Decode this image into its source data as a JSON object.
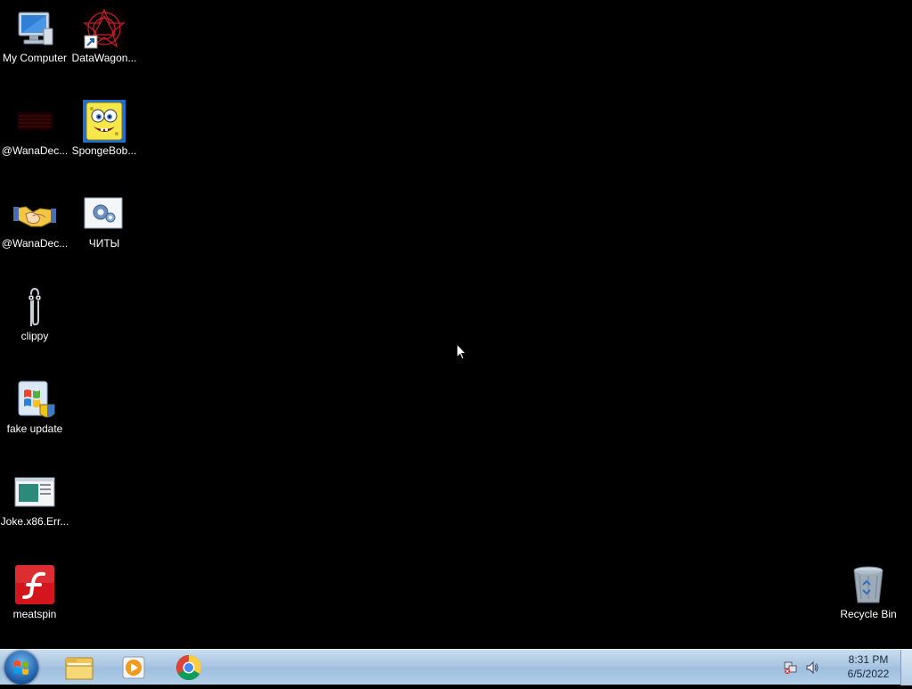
{
  "desktop": {
    "icons": [
      {
        "id": "my-computer",
        "label": "My Computer"
      },
      {
        "id": "datawagon",
        "label": "DataWagon..."
      },
      {
        "id": "wana1",
        "label": "@WanaDec..."
      },
      {
        "id": "spongebob",
        "label": "SpongeBob..."
      },
      {
        "id": "wana2",
        "label": "@WanaDec..."
      },
      {
        "id": "chity",
        "label": "ЧИТЫ"
      },
      {
        "id": "clippy",
        "label": "clippy"
      },
      {
        "id": "fake-update",
        "label": "fake update"
      },
      {
        "id": "joke",
        "label": "Joke.x86.Err..."
      },
      {
        "id": "meatspin",
        "label": "meatspin"
      },
      {
        "id": "recycle-bin",
        "label": "Recycle Bin"
      }
    ]
  },
  "taskbar": {
    "pinned": [
      {
        "name": "windows-explorer",
        "icon": "folder-icon"
      },
      {
        "name": "windows-media-player",
        "icon": "media-player-icon"
      },
      {
        "name": "google-chrome",
        "icon": "chrome-icon"
      }
    ],
    "tray": {
      "time": "8:31 PM",
      "date": "6/5/2022"
    }
  },
  "colors": {
    "desktop_bg": "#000000",
    "taskbar_bg": "#a9c6e2"
  }
}
